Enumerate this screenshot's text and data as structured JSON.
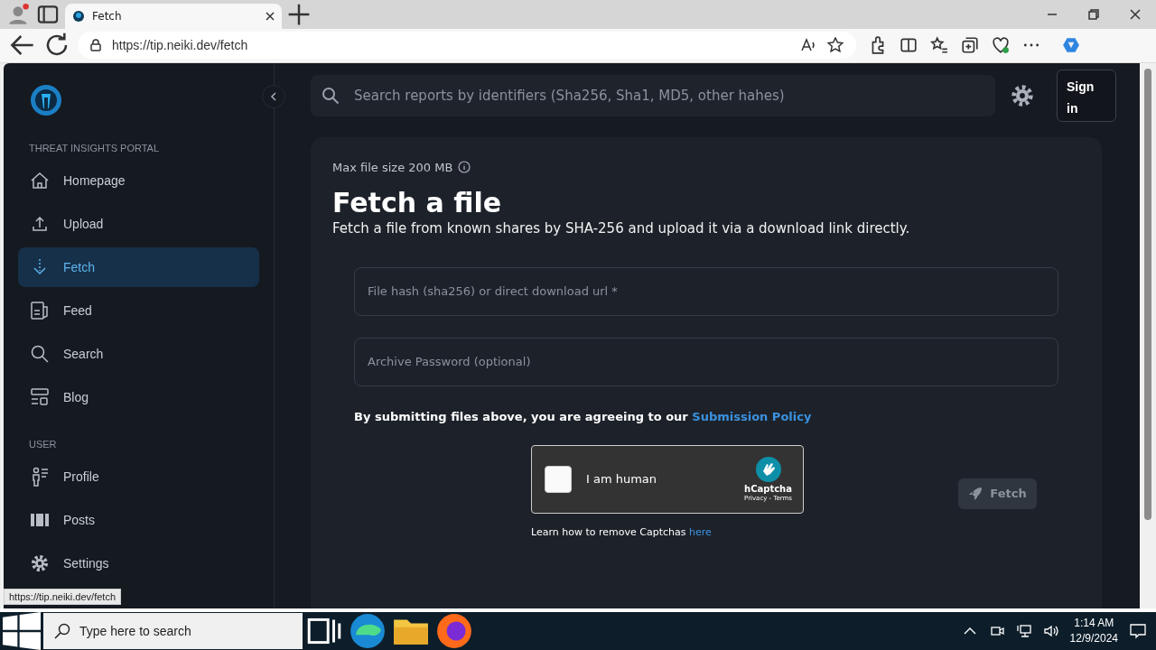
{
  "browser": {
    "tabs": [
      {
        "title": "Fetch",
        "selected": true
      }
    ],
    "address": "https://tip.neiki.dev/fetch"
  },
  "sidebar": {
    "sections": [
      {
        "heading": "THREAT INSIGHTS PORTAL",
        "items": [
          {
            "label": "Homepage",
            "selected": false
          },
          {
            "label": "Upload",
            "selected": false
          },
          {
            "label": "Fetch",
            "selected": true
          },
          {
            "label": "Feed",
            "selected": false
          },
          {
            "label": "Search",
            "selected": false
          },
          {
            "label": "Blog",
            "selected": false
          }
        ]
      },
      {
        "heading": "USER",
        "items": [
          {
            "label": "Profile",
            "selected": false
          },
          {
            "label": "Posts",
            "selected": false
          },
          {
            "label": "Settings",
            "selected": false
          }
        ]
      }
    ]
  },
  "topbar": {
    "search": {
      "placeholder": "Search reports by identifiers (Sha256, Sha1, MD5, other hahes)"
    },
    "sign_in": "Sign in"
  },
  "card": {
    "note": "Max file size 200 MB",
    "title": "Fetch a file",
    "subtitle": "Fetch a file from known shares by SHA-256 and upload it via a download link directly.",
    "fields": [
      {
        "placeholder": "File hash (sha256) or direct download url *"
      },
      {
        "placeholder": "Archive Password (optional)"
      }
    ],
    "policy": {
      "text": "By submitting files above, you are agreeing to our",
      "link": "Submission Policy"
    },
    "captcha": {
      "label": "I am human",
      "checked": false,
      "brand": "hCaptcha",
      "links": "Privacy - Terms"
    },
    "captcha_help": {
      "text": "Learn how to remove Captchas",
      "link": "here"
    },
    "submit": {
      "label": "Fetch",
      "disabled": true
    }
  },
  "status_url": "https://tip.neiki.dev/fetch",
  "taskbar": {
    "search_placeholder": "Type here to search",
    "time": "1:14 AM",
    "date": "12/9/2024"
  }
}
